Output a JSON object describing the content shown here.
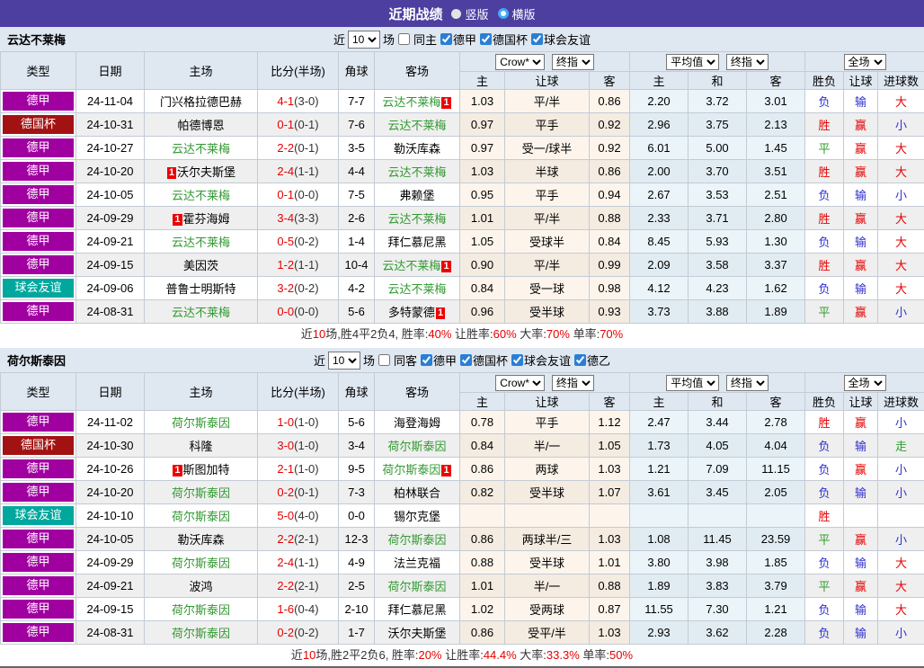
{
  "topbar": {
    "title": "近期战绩",
    "radios": [
      {
        "label": "竖版",
        "selected": false
      },
      {
        "label": "横版",
        "selected": true
      }
    ]
  },
  "colors": {
    "topbar_bg": "#4c3fa0",
    "section_bg": "#dfe7f1",
    "team_self_green": "#339933",
    "score_red": "#e60000",
    "result_red": "#e60000",
    "result_blue": "#3030d0",
    "result_green": "#2f9e2f",
    "badge_red": "#ee0000"
  },
  "league_colors": {
    "德甲": "#a100a1",
    "德国杯": "#a31212",
    "球会友谊": "#00a79d",
    "德乙": "#a100a1"
  },
  "result_color_map": {
    "胜": "res-red",
    "负": "res-blue",
    "平": "res-green",
    "赢": "res-red",
    "输": "res-blue",
    "走": "res-green",
    "大": "res-red",
    "小": "res-blue"
  },
  "header": {
    "cols": [
      "类型",
      "日期",
      "主场",
      "比分(半场)",
      "角球",
      "客场"
    ],
    "dropdowns": [
      "Crow*",
      "终指",
      "平均值",
      "终指",
      "全场"
    ],
    "sub": [
      "主",
      "让球",
      "客",
      "主",
      "和",
      "客",
      "胜负",
      "让球",
      "进球数"
    ]
  },
  "sections": [
    {
      "team": "云达不莱梅",
      "filter": {
        "prefix": "近",
        "games": "10",
        "suffix": "场",
        "same_label": "同主",
        "same_checked": false,
        "leagues": [
          "德甲",
          "德国杯",
          "球会友谊"
        ]
      },
      "rows": [
        {
          "type": "德甲",
          "date": "24-11-04",
          "home": "门兴格拉德巴赫",
          "home_self": false,
          "home_badge": "",
          "score": "4-1",
          "half": "(3-0)",
          "corner": "7-7",
          "away": "云达不莱梅",
          "away_self": true,
          "away_badge": "1",
          "o1": "1.03",
          "o2": "平/半",
          "o3": "0.86",
          "a1": "2.20",
          "a2": "3.72",
          "a3": "3.01",
          "r1": "负",
          "r2": "输",
          "r3": "大"
        },
        {
          "type": "德国杯",
          "date": "24-10-31",
          "home": "帕德博恩",
          "home_self": false,
          "home_badge": "",
          "score": "0-1",
          "half": "(0-1)",
          "corner": "7-6",
          "away": "云达不莱梅",
          "away_self": true,
          "away_badge": "",
          "o1": "0.97",
          "o2": "平手",
          "o3": "0.92",
          "a1": "2.96",
          "a2": "3.75",
          "a3": "2.13",
          "r1": "胜",
          "r2": "赢",
          "r3": "小"
        },
        {
          "type": "德甲",
          "date": "24-10-27",
          "home": "云达不莱梅",
          "home_self": true,
          "home_badge": "",
          "score": "2-2",
          "half": "(0-1)",
          "corner": "3-5",
          "away": "勒沃库森",
          "away_self": false,
          "away_badge": "",
          "o1": "0.97",
          "o2": "受一/球半",
          "o3": "0.92",
          "a1": "6.01",
          "a2": "5.00",
          "a3": "1.45",
          "r1": "平",
          "r2": "赢",
          "r3": "大"
        },
        {
          "type": "德甲",
          "date": "24-10-20",
          "home": "沃尔夫斯堡",
          "home_self": false,
          "home_badge": "1",
          "score": "2-4",
          "half": "(1-1)",
          "corner": "4-4",
          "away": "云达不莱梅",
          "away_self": true,
          "away_badge": "",
          "o1": "1.03",
          "o2": "半球",
          "o3": "0.86",
          "a1": "2.00",
          "a2": "3.70",
          "a3": "3.51",
          "r1": "胜",
          "r2": "赢",
          "r3": "大"
        },
        {
          "type": "德甲",
          "date": "24-10-05",
          "home": "云达不莱梅",
          "home_self": true,
          "home_badge": "",
          "score": "0-1",
          "half": "(0-0)",
          "corner": "7-5",
          "away": "弗赖堡",
          "away_self": false,
          "away_badge": "",
          "o1": "0.95",
          "o2": "平手",
          "o3": "0.94",
          "a1": "2.67",
          "a2": "3.53",
          "a3": "2.51",
          "r1": "负",
          "r2": "输",
          "r3": "小"
        },
        {
          "type": "德甲",
          "date": "24-09-29",
          "home": "霍芬海姆",
          "home_self": false,
          "home_badge": "1",
          "score": "3-4",
          "half": "(3-3)",
          "corner": "2-6",
          "away": "云达不莱梅",
          "away_self": true,
          "away_badge": "",
          "o1": "1.01",
          "o2": "平/半",
          "o3": "0.88",
          "a1": "2.33",
          "a2": "3.71",
          "a3": "2.80",
          "r1": "胜",
          "r2": "赢",
          "r3": "大"
        },
        {
          "type": "德甲",
          "date": "24-09-21",
          "home": "云达不莱梅",
          "home_self": true,
          "home_badge": "",
          "score": "0-5",
          "half": "(0-2)",
          "corner": "1-4",
          "away": "拜仁慕尼黑",
          "away_self": false,
          "away_badge": "",
          "o1": "1.05",
          "o2": "受球半",
          "o3": "0.84",
          "a1": "8.45",
          "a2": "5.93",
          "a3": "1.30",
          "r1": "负",
          "r2": "输",
          "r3": "大"
        },
        {
          "type": "德甲",
          "date": "24-09-15",
          "home": "美因茨",
          "home_self": false,
          "home_badge": "",
          "score": "1-2",
          "half": "(1-1)",
          "corner": "10-4",
          "away": "云达不莱梅",
          "away_self": true,
          "away_badge": "1",
          "o1": "0.90",
          "o2": "平/半",
          "o3": "0.99",
          "a1": "2.09",
          "a2": "3.58",
          "a3": "3.37",
          "r1": "胜",
          "r2": "赢",
          "r3": "大"
        },
        {
          "type": "球会友谊",
          "date": "24-09-06",
          "home": "普鲁士明斯特",
          "home_self": false,
          "home_badge": "",
          "score": "3-2",
          "half": "(0-2)",
          "corner": "4-2",
          "away": "云达不莱梅",
          "away_self": true,
          "away_badge": "",
          "o1": "0.84",
          "o2": "受一球",
          "o3": "0.98",
          "a1": "4.12",
          "a2": "4.23",
          "a3": "1.62",
          "r1": "负",
          "r2": "输",
          "r3": "大"
        },
        {
          "type": "德甲",
          "date": "24-08-31",
          "home": "云达不莱梅",
          "home_self": true,
          "home_badge": "",
          "score": "0-0",
          "half": "(0-0)",
          "corner": "5-6",
          "away": "多特蒙德",
          "away_self": false,
          "away_badge": "1",
          "o1": "0.96",
          "o2": "受半球",
          "o3": "0.93",
          "a1": "3.73",
          "a2": "3.88",
          "a3": "1.89",
          "r1": "平",
          "r2": "赢",
          "r3": "小"
        }
      ],
      "summary": [
        {
          "t": "近",
          "red": false
        },
        {
          "t": "10",
          "red": true
        },
        {
          "t": "场,胜4平2负4, 胜率:",
          "red": false
        },
        {
          "t": "40%",
          "red": true
        },
        {
          "t": " 让胜率:",
          "red": false
        },
        {
          "t": "60%",
          "red": true
        },
        {
          "t": " 大率:",
          "red": false
        },
        {
          "t": "70%",
          "red": true
        },
        {
          "t": " 单率:",
          "red": false
        },
        {
          "t": "70%",
          "red": true
        }
      ]
    },
    {
      "team": "荷尔斯泰因",
      "filter": {
        "prefix": "近",
        "games": "10",
        "suffix": "场",
        "same_label": "同客",
        "same_checked": false,
        "leagues": [
          "德甲",
          "德国杯",
          "球会友谊",
          "德乙"
        ]
      },
      "rows": [
        {
          "type": "德甲",
          "date": "24-11-02",
          "home": "荷尔斯泰因",
          "home_self": true,
          "home_badge": "",
          "score": "1-0",
          "half": "(1-0)",
          "corner": "5-6",
          "away": "海登海姆",
          "away_self": false,
          "away_badge": "",
          "o1": "0.78",
          "o2": "平手",
          "o3": "1.12",
          "a1": "2.47",
          "a2": "3.44",
          "a3": "2.78",
          "r1": "胜",
          "r2": "赢",
          "r3": "小"
        },
        {
          "type": "德国杯",
          "date": "24-10-30",
          "home": "科隆",
          "home_self": false,
          "home_badge": "",
          "score": "3-0",
          "half": "(1-0)",
          "corner": "3-4",
          "away": "荷尔斯泰因",
          "away_self": true,
          "away_badge": "",
          "o1": "0.84",
          "o2": "半/一",
          "o3": "1.05",
          "a1": "1.73",
          "a2": "4.05",
          "a3": "4.04",
          "r1": "负",
          "r2": "输",
          "r3": "走"
        },
        {
          "type": "德甲",
          "date": "24-10-26",
          "home": "斯图加特",
          "home_self": false,
          "home_badge": "1",
          "score": "2-1",
          "half": "(1-0)",
          "corner": "9-5",
          "away": "荷尔斯泰因",
          "away_self": true,
          "away_badge": "1",
          "o1": "0.86",
          "o2": "两球",
          "o3": "1.03",
          "a1": "1.21",
          "a2": "7.09",
          "a3": "11.15",
          "r1": "负",
          "r2": "赢",
          "r3": "小"
        },
        {
          "type": "德甲",
          "date": "24-10-20",
          "home": "荷尔斯泰因",
          "home_self": true,
          "home_badge": "",
          "score": "0-2",
          "half": "(0-1)",
          "corner": "7-3",
          "away": "柏林联合",
          "away_self": false,
          "away_badge": "",
          "o1": "0.82",
          "o2": "受半球",
          "o3": "1.07",
          "a1": "3.61",
          "a2": "3.45",
          "a3": "2.05",
          "r1": "负",
          "r2": "输",
          "r3": "小"
        },
        {
          "type": "球会友谊",
          "date": "24-10-10",
          "home": "荷尔斯泰因",
          "home_self": true,
          "home_badge": "",
          "score": "5-0",
          "half": "(4-0)",
          "corner": "0-0",
          "away": "锡尔克堡",
          "away_self": false,
          "away_badge": "",
          "o1": "",
          "o2": "",
          "o3": "",
          "a1": "",
          "a2": "",
          "a3": "",
          "r1": "胜",
          "r2": "",
          "r3": ""
        },
        {
          "type": "德甲",
          "date": "24-10-05",
          "home": "勒沃库森",
          "home_self": false,
          "home_badge": "",
          "score": "2-2",
          "half": "(2-1)",
          "corner": "12-3",
          "away": "荷尔斯泰因",
          "away_self": true,
          "away_badge": "",
          "o1": "0.86",
          "o2": "两球半/三",
          "o3": "1.03",
          "a1": "1.08",
          "a2": "11.45",
          "a3": "23.59",
          "r1": "平",
          "r2": "赢",
          "r3": "小"
        },
        {
          "type": "德甲",
          "date": "24-09-29",
          "home": "荷尔斯泰因",
          "home_self": true,
          "home_badge": "",
          "score": "2-4",
          "half": "(1-1)",
          "corner": "4-9",
          "away": "法兰克福",
          "away_self": false,
          "away_badge": "",
          "o1": "0.88",
          "o2": "受半球",
          "o3": "1.01",
          "a1": "3.80",
          "a2": "3.98",
          "a3": "1.85",
          "r1": "负",
          "r2": "输",
          "r3": "大"
        },
        {
          "type": "德甲",
          "date": "24-09-21",
          "home": "波鸿",
          "home_self": false,
          "home_badge": "",
          "score": "2-2",
          "half": "(2-1)",
          "corner": "2-5",
          "away": "荷尔斯泰因",
          "away_self": true,
          "away_badge": "",
          "o1": "1.01",
          "o2": "半/一",
          "o3": "0.88",
          "a1": "1.89",
          "a2": "3.83",
          "a3": "3.79",
          "r1": "平",
          "r2": "赢",
          "r3": "大"
        },
        {
          "type": "德甲",
          "date": "24-09-15",
          "home": "荷尔斯泰因",
          "home_self": true,
          "home_badge": "",
          "score": "1-6",
          "half": "(0-4)",
          "corner": "2-10",
          "away": "拜仁慕尼黑",
          "away_self": false,
          "away_badge": "",
          "o1": "1.02",
          "o2": "受两球",
          "o3": "0.87",
          "a1": "11.55",
          "a2": "7.30",
          "a3": "1.21",
          "r1": "负",
          "r2": "输",
          "r3": "大"
        },
        {
          "type": "德甲",
          "date": "24-08-31",
          "home": "荷尔斯泰因",
          "home_self": true,
          "home_badge": "",
          "score": "0-2",
          "half": "(0-2)",
          "corner": "1-7",
          "away": "沃尔夫斯堡",
          "away_self": false,
          "away_badge": "",
          "o1": "0.86",
          "o2": "受平/半",
          "o3": "1.03",
          "a1": "2.93",
          "a2": "3.62",
          "a3": "2.28",
          "r1": "负",
          "r2": "输",
          "r3": "小"
        }
      ],
      "summary": [
        {
          "t": "近",
          "red": false
        },
        {
          "t": "10",
          "red": true
        },
        {
          "t": "场,胜2平2负6, 胜率:",
          "red": false
        },
        {
          "t": "20%",
          "red": true
        },
        {
          "t": " 让胜率:",
          "red": false
        },
        {
          "t": "44.4%",
          "red": true
        },
        {
          "t": " 大率:",
          "red": false
        },
        {
          "t": "33.3%",
          "red": true
        },
        {
          "t": " 单率:",
          "red": false
        },
        {
          "t": "50%",
          "red": true
        }
      ]
    }
  ]
}
